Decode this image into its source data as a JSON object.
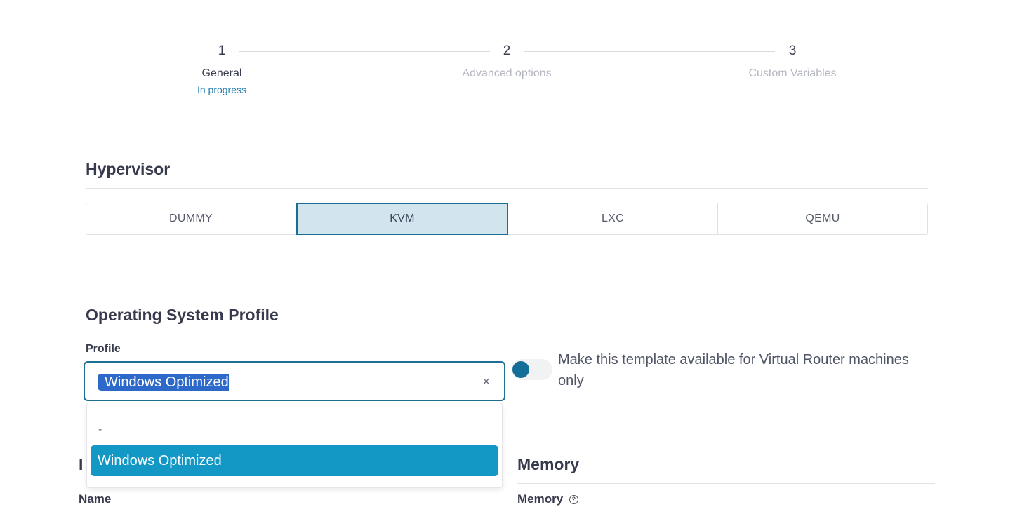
{
  "stepper": [
    {
      "number": "1",
      "title": "General",
      "status": "In progress"
    },
    {
      "number": "2",
      "title": "Advanced options"
    },
    {
      "number": "3",
      "title": "Custom Variables"
    }
  ],
  "hypervisor": {
    "heading": "Hypervisor",
    "options": [
      "DUMMY",
      "KVM",
      "LXC",
      "QEMU"
    ],
    "selected": "KVM"
  },
  "os_profile": {
    "heading": "Operating System Profile",
    "field_label": "Profile",
    "value": "Windows Optimized",
    "clear_glyph": "×",
    "dropdown_options": [
      "-",
      "Windows Optimized"
    ],
    "toggle_label": "Make this template available for Virtual Router machines only",
    "toggle_on": true
  },
  "lower": {
    "left_heading_fragment": "I",
    "left_field_label": "Name",
    "memory_heading": "Memory",
    "memory_field_label": "Memory",
    "help_glyph": "?"
  }
}
